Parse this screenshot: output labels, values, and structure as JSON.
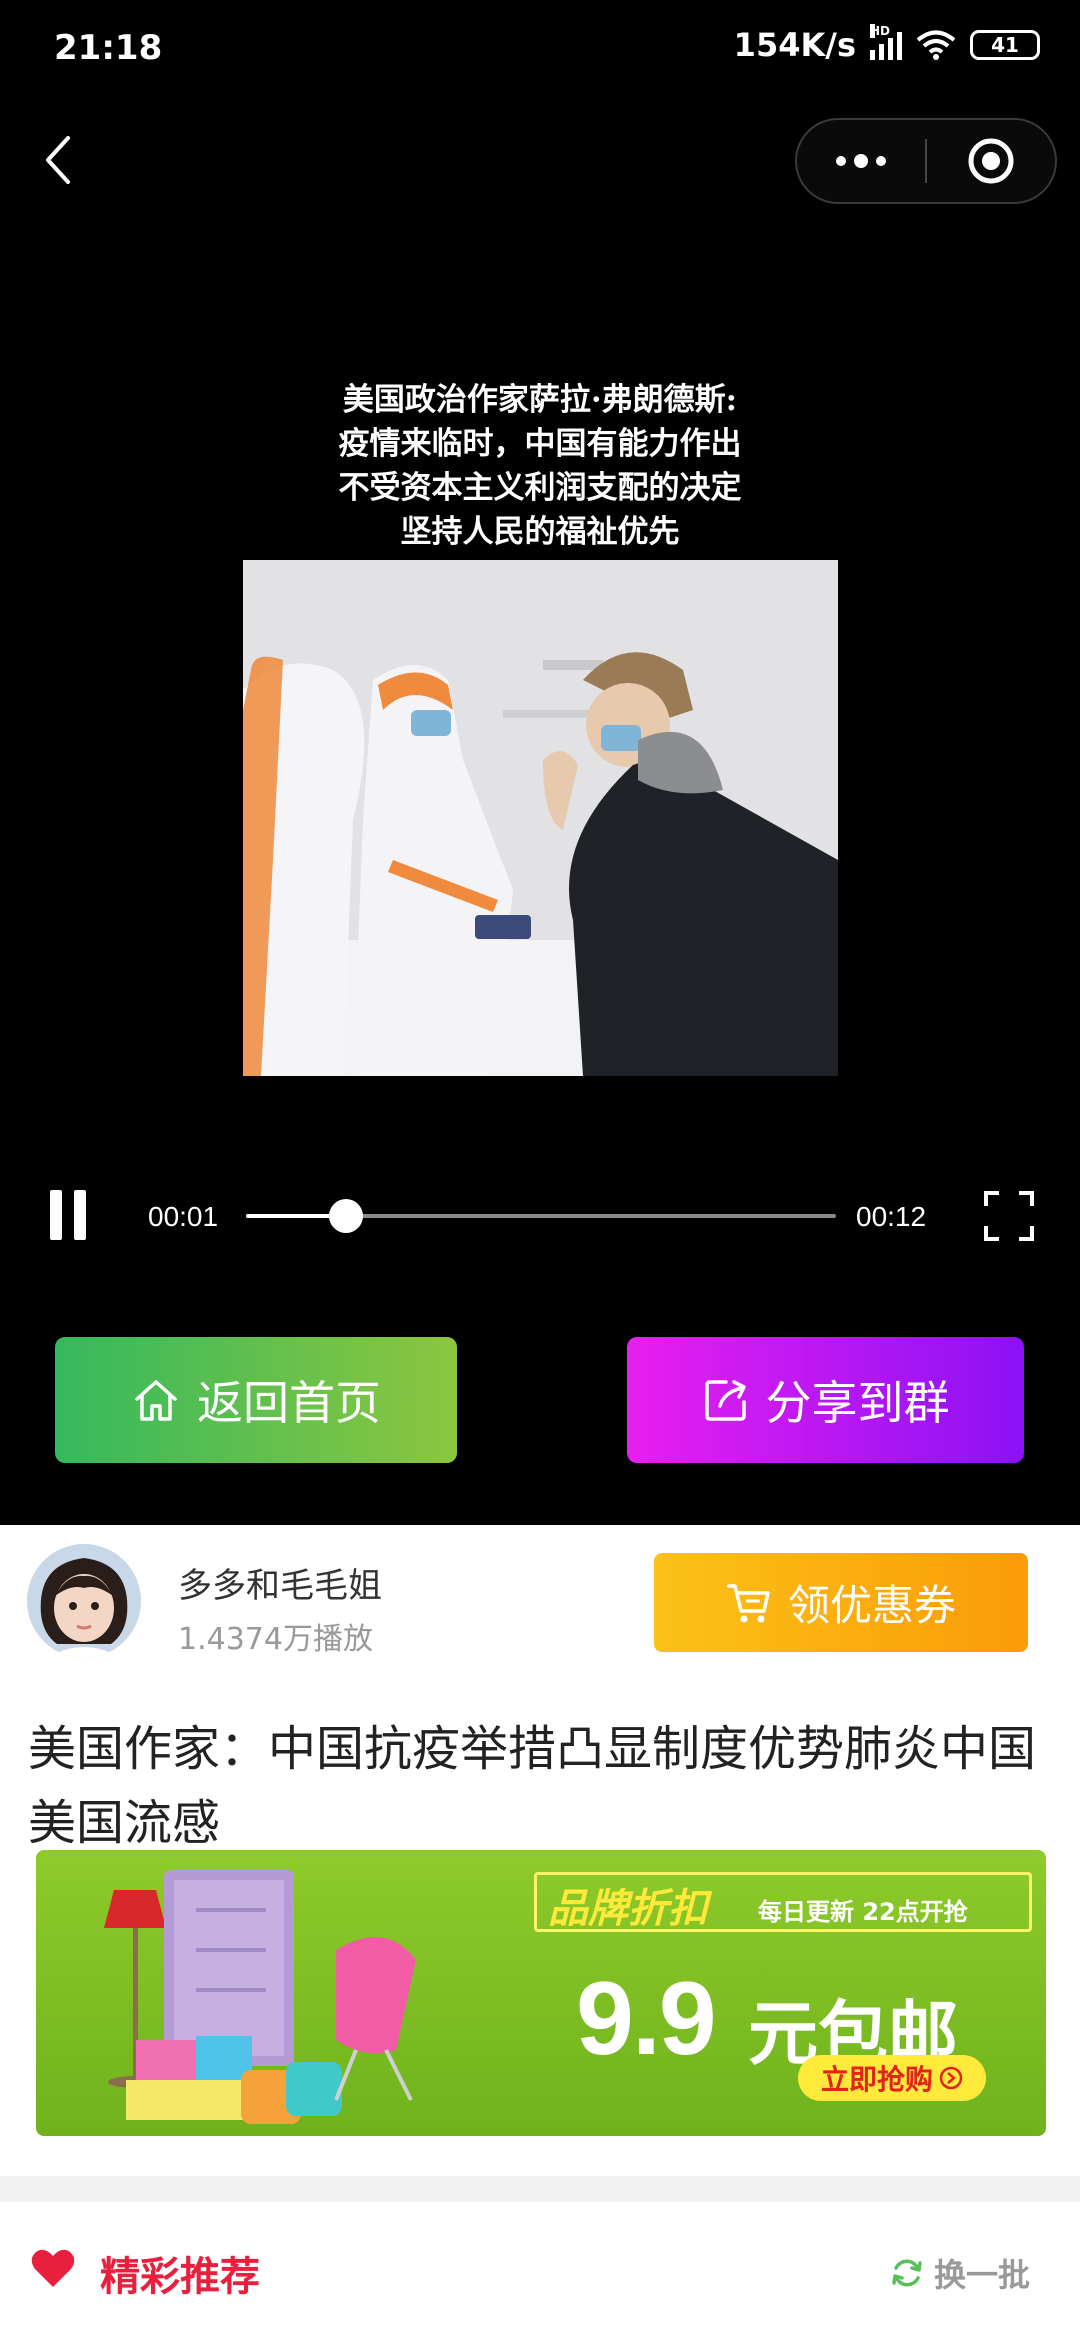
{
  "status_bar": {
    "time": "21:18",
    "net_speed": "154K/s",
    "signal_badge": "HD",
    "battery": "41",
    "icons": [
      "signal-icon",
      "wifi-icon",
      "battery-icon"
    ]
  },
  "nav": {
    "back_icon": "chevron-left-icon",
    "menu_icon": "more-dots-icon",
    "close_icon": "target-icon"
  },
  "video": {
    "caption_lines": [
      "美国政治作家萨拉·弗朗德斯:",
      "疫情来临时，中国有能力作出",
      "不受资本主义利润支配的决定",
      "坚持人民的福祉优先"
    ],
    "current_time": "00:01",
    "total_time": "00:12",
    "progress_fraction": 0.17
  },
  "actions": {
    "home_label": "返回首页",
    "share_label": "分享到群"
  },
  "author": {
    "name": "多多和毛毛姐",
    "plays": "1.4374万播放",
    "coupon_label": "领优惠券"
  },
  "title": "美国作家：中国抗疫举措凸显制度优势肺炎中国美国流感",
  "banner": {
    "tag_main": "品牌折扣",
    "tag_sub": "每日更新 22点开抢",
    "price": "9.9",
    "price_unit": "元包邮",
    "cta": "立即抢购"
  },
  "recommend": {
    "title": "精彩推荐",
    "refresh": "换一批"
  },
  "colors": {
    "home_gradient": [
      "#35b95d",
      "#8cc63f"
    ],
    "share_gradient": [
      "#e91ef0",
      "#8b12f5"
    ],
    "coupon_gradient": [
      "#fbc218",
      "#fb9b08"
    ],
    "recommend_red": "#e8203d"
  }
}
